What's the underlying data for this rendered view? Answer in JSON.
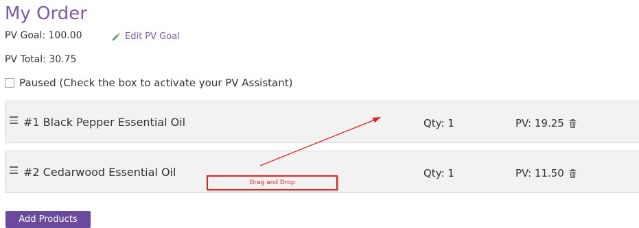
{
  "order": {
    "title": "My Order",
    "pv_goal_text": "PV Goal: 100.00",
    "edit_pv_goal_label": "Edit PV Goal",
    "pv_total_text": "PV Total: 30.75",
    "paused_label": "Paused (Check the box to activate your PV Assistant)",
    "paused_checked": false
  },
  "items": [
    {
      "name": "#1  Black Pepper Essential Oil",
      "qty": "Qty: 1",
      "pv": "PV: 19.25"
    },
    {
      "name": "#2  Cedarwood Essential Oil",
      "qty": "Qty: 1",
      "pv": "PV: 11.50"
    }
  ],
  "annotation": {
    "text": "Drag and Drop",
    "color": "#e0221b"
  },
  "add_products_label": "Add Products",
  "colors": {
    "accent": "#7b5ba6",
    "button": "#6a4a9e"
  }
}
